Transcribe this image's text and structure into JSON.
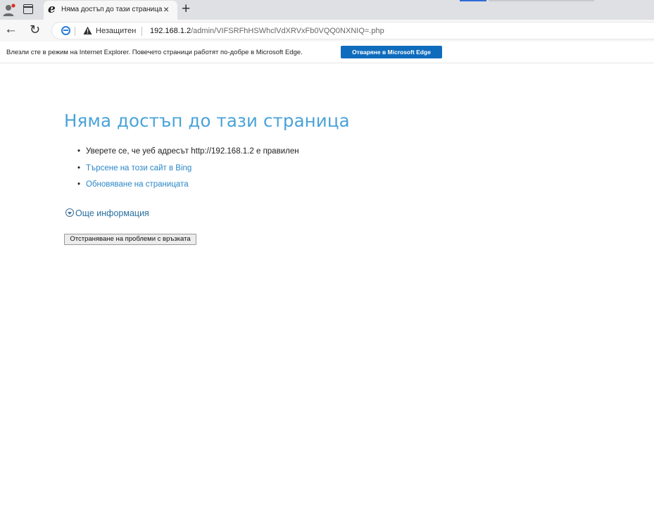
{
  "browser": {
    "tab": {
      "title": "Няма достъп до тази страница",
      "close_glyph": "×",
      "icon": "ie-icon"
    },
    "new_tab_glyph": "+",
    "nav": {
      "back_glyph": "←",
      "reload_glyph": "↻"
    },
    "address_bar": {
      "security_label": "Незащитен",
      "url_host": "192.168.1.2",
      "url_path": "/admin/VIFSRFhHSWhclVdXRVxFb0VQQ0NXNIQ=.php"
    }
  },
  "infobar": {
    "message": "Влезли сте в режим на Internet Explorer. Повечето страници работят по-добре в Microsoft Edge.",
    "button_label": "Отваряне в Microsoft Edge"
  },
  "error_page": {
    "heading": "Няма достъп до тази страница",
    "bullet_glyph": "•",
    "items": [
      {
        "text": "Уверете се, че уеб адресът http://192.168.1.2 е правилен",
        "is_link": false
      },
      {
        "text": "Търсене на този сайт в Bing",
        "is_link": true
      },
      {
        "text": "Обновяване на страницата",
        "is_link": true
      }
    ],
    "more_info": "Още информация",
    "diagnose_button": "Отстраняване на проблеми с връзката"
  },
  "colors": {
    "heading": "#4aa3d8",
    "link": "#2a88c8",
    "edge_button": "#0f6cbd"
  }
}
